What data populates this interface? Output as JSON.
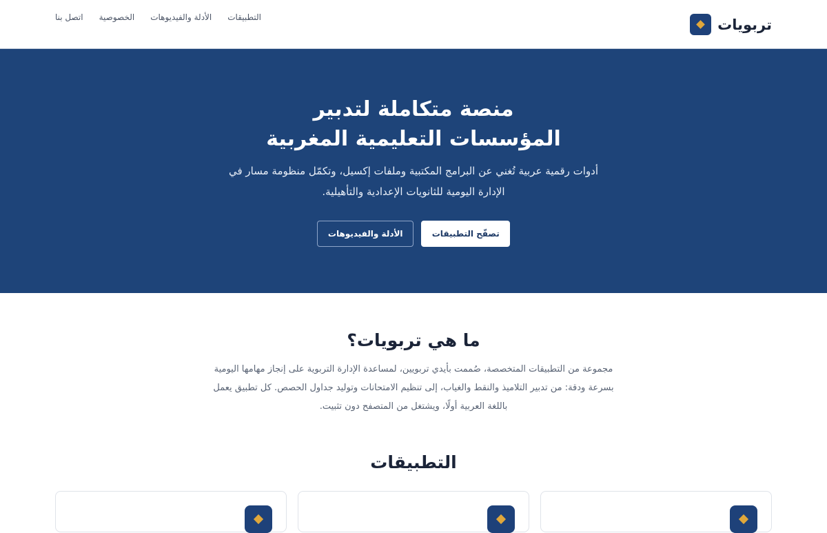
{
  "header": {
    "brand_name": "تربويات",
    "brand_icon": "diamond-icon",
    "nav": [
      {
        "label": "التطبيقات"
      },
      {
        "label": "الأدلة والفيديوهات"
      },
      {
        "label": "الخصوصية"
      },
      {
        "label": "اتصل بنا"
      }
    ]
  },
  "hero": {
    "title_line1": "منصة متكاملة لتدبير",
    "title_line2": "المؤسسات التعليمية المغربية",
    "subtitle": "أدوات رقمية عربية تُغني عن البرامج المكتبية وملفات إكسيل، وتكمّل منظومة مسار في الإدارة اليومية للثانويات الإعدادية والتأهيلية.",
    "primary_button": "تصفّح التطبيقات",
    "secondary_button": "الأدلة والفيديوهات"
  },
  "about": {
    "title": "ما هي تربويات؟",
    "text": "مجموعة من التطبيقات المتخصصة، صُممت بأيدي تربويين، لمساعدة الإدارة التربوية على إنجاز مهامها اليومية بسرعة ودقة: من تدبير التلاميذ والنقط والغياب، إلى تنظيم الامتحانات وتوليد جداول الحصص. كل تطبيق يعمل باللغة العربية أولًا، ويشتغل من المتصفح دون تثبيت."
  },
  "apps": {
    "title": "التطبيقات",
    "cards": [
      {
        "icon": "diamond-icon"
      },
      {
        "icon": "diamond-icon"
      },
      {
        "icon": "diamond-icon"
      }
    ]
  },
  "colors": {
    "primary": "#1e4479",
    "accent": "#e0a73b",
    "text_dark": "#1b2438",
    "text_muted": "#5a6475"
  }
}
